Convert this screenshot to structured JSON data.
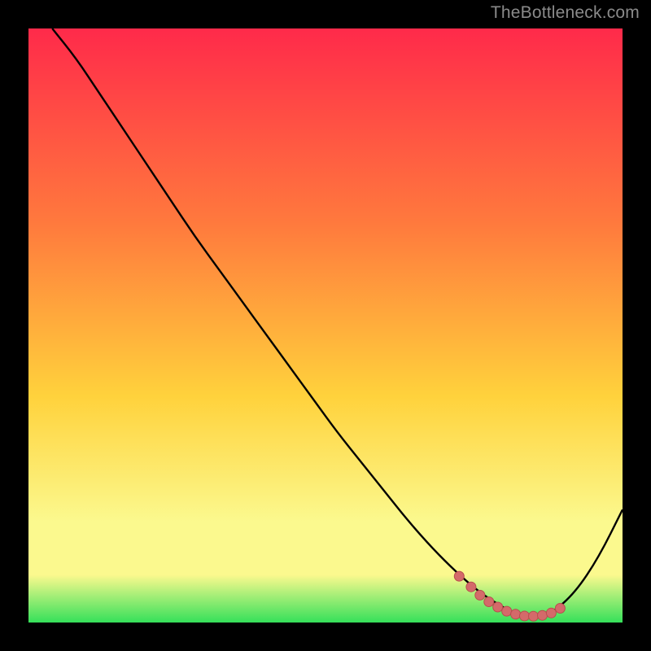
{
  "watermark": "TheBottleneck.com",
  "colors": {
    "background": "#000000",
    "gradient_top": "#ff2a4a",
    "gradient_mid1": "#ff7a3d",
    "gradient_mid2": "#ffd23c",
    "gradient_low": "#fbf98e",
    "gradient_bottom": "#35e05a",
    "curve": "#000000",
    "marker_fill": "#d46a6a",
    "marker_stroke": "#b94e4e"
  },
  "chart_data": {
    "type": "line",
    "title": "",
    "xlabel": "",
    "ylabel": "",
    "xlim": [
      0,
      100
    ],
    "ylim": [
      0,
      100
    ],
    "grid": false,
    "legend": false,
    "series": [
      {
        "name": "bottleneck-curve",
        "x": [
          4,
          8,
          12,
          16,
          20,
          24,
          28,
          32,
          36,
          40,
          44,
          48,
          52,
          56,
          60,
          64,
          68,
          72,
          76,
          80,
          82,
          84,
          86,
          88,
          92,
          96,
          100
        ],
        "y": [
          100,
          95,
          89,
          83,
          77,
          71,
          65,
          59.5,
          54,
          48.5,
          43,
          37.5,
          32,
          27,
          22,
          17,
          12.5,
          8.5,
          5,
          2.5,
          1.5,
          1,
          1,
          1.5,
          5,
          11,
          19
        ]
      }
    ],
    "markers": {
      "name": "valley-points",
      "x": [
        72.5,
        74.5,
        76,
        77.5,
        79,
        80.5,
        82,
        83.5,
        85,
        86.5,
        88,
        89.5
      ],
      "y": [
        7.8,
        6.0,
        4.6,
        3.5,
        2.6,
        1.9,
        1.4,
        1.1,
        1.05,
        1.2,
        1.6,
        2.4
      ]
    }
  }
}
